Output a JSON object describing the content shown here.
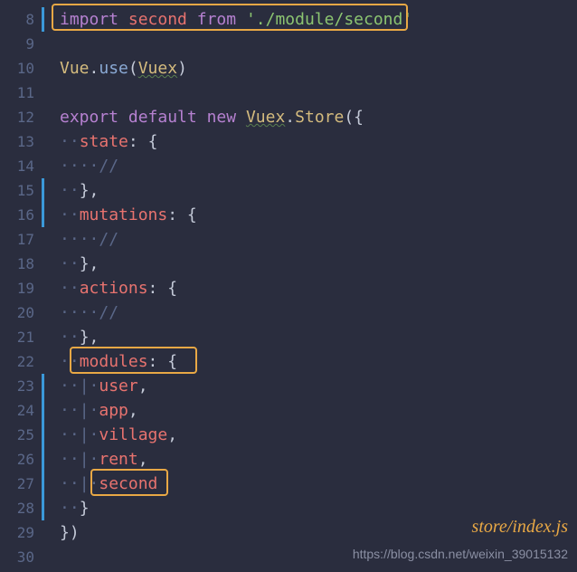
{
  "gutter": {
    "start": 8,
    "end": 30
  },
  "code": {
    "l8": {
      "t1": "import",
      "t2": "second",
      "t3": "from",
      "t4": "'./module/second'"
    },
    "l10": {
      "t1": "Vue",
      "t2": ".",
      "t3": "use",
      "t4": "(",
      "t5": "Vuex",
      "t6": ")"
    },
    "l12": {
      "t1": "export",
      "t2": "default",
      "t3": "new",
      "t4": "Vuex",
      "t5": ".",
      "t6": "Store",
      "t7": "(",
      "t8": "{"
    },
    "l13": {
      "t1": "state",
      "t2": ":",
      "t3": "{"
    },
    "l14": {
      "t1": "//"
    },
    "l15": {
      "t1": "}",
      "t2": ","
    },
    "l16": {
      "t1": "mutations",
      "t2": ":",
      "t3": "{"
    },
    "l17": {
      "t1": "//"
    },
    "l18": {
      "t1": "}",
      "t2": ","
    },
    "l19": {
      "t1": "actions",
      "t2": ":",
      "t3": "{"
    },
    "l20": {
      "t1": "//"
    },
    "l21": {
      "t1": "}",
      "t2": ","
    },
    "l22": {
      "t1": "modules",
      "t2": ":",
      "t3": "{"
    },
    "l23": {
      "t1": "user",
      "t2": ","
    },
    "l24": {
      "t1": "app",
      "t2": ","
    },
    "l25": {
      "t1": "village",
      "t2": ","
    },
    "l26": {
      "t1": "rent",
      "t2": ","
    },
    "l27": {
      "t1": "second"
    },
    "l28": {
      "t1": "}"
    },
    "l29": {
      "t1": "}",
      "t2": ")"
    }
  },
  "fileLabel": "store/index.js",
  "watermark": "https://blog.csdn.net/weixin_39015132",
  "indent": {
    "dot2": "··",
    "dot4": "····",
    "pipe": "|"
  }
}
